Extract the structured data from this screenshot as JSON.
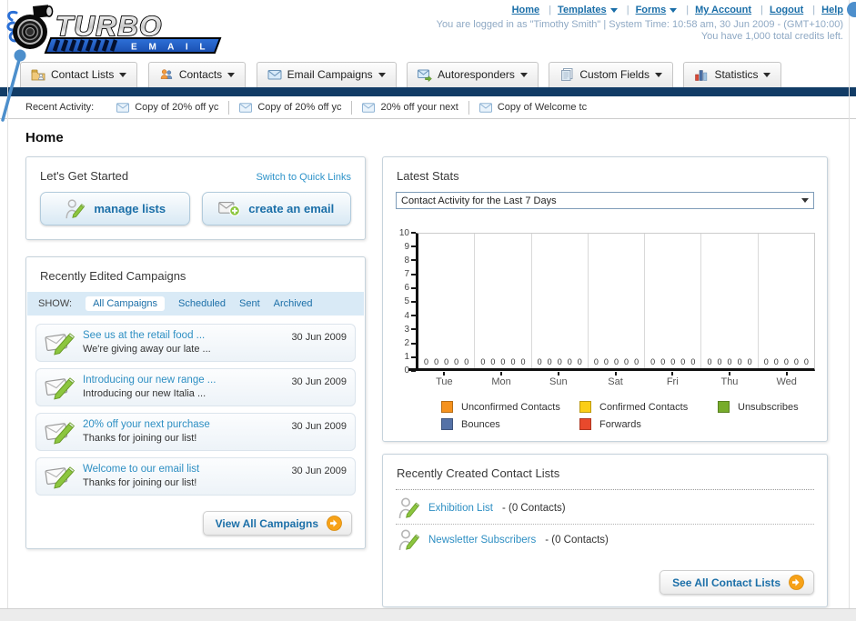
{
  "brand": {
    "name": "TURBO",
    "sub": "E M A I L"
  },
  "header": {
    "nav_links": [
      {
        "label": "Home",
        "dropdown": false
      },
      {
        "label": "Templates",
        "dropdown": true
      },
      {
        "label": "Forms",
        "dropdown": true
      },
      {
        "label": "My Account",
        "dropdown": false
      },
      {
        "label": "Logout",
        "dropdown": false
      },
      {
        "label": "Help",
        "dropdown": false
      }
    ],
    "login_line1": "You are logged in as \"Timothy Smith\" | System Time: 10:58 am, 30 Jun 2009 - (GMT+10:00)",
    "login_line2": "You have 1,000 total credits left."
  },
  "main_nav": {
    "tabs": [
      {
        "label": "Contact Lists",
        "icon": "contact-lists-icon"
      },
      {
        "label": "Contacts",
        "icon": "contacts-icon"
      },
      {
        "label": "Email Campaigns",
        "icon": "email-campaigns-icon"
      },
      {
        "label": "Autoresponders",
        "icon": "autoresponders-icon"
      },
      {
        "label": "Custom Fields",
        "icon": "custom-fields-icon"
      },
      {
        "label": "Statistics",
        "icon": "statistics-icon"
      }
    ]
  },
  "recent_activity": {
    "label": "Recent Activity:",
    "items": [
      {
        "label": "Copy of 20% off yc",
        "icon": "envelope-icon"
      },
      {
        "label": "Copy of 20% off yc",
        "icon": "envelope-icon"
      },
      {
        "label": "20% off your next ",
        "icon": "envelope-icon"
      },
      {
        "label": "Copy of Welcome tc",
        "icon": "envelope-icon"
      }
    ]
  },
  "page_title": "Home",
  "get_started": {
    "title": "Let's Get Started",
    "switch_link": "Switch to Quick Links",
    "buttons": [
      {
        "label": "manage lists",
        "icon": "person-pencil-icon"
      },
      {
        "label": "create an email",
        "icon": "envelope-plus-icon"
      }
    ]
  },
  "campaigns": {
    "title": "Recently Edited Campaigns",
    "show_label": "SHOW:",
    "filters": [
      {
        "label": "All Campaigns",
        "active": true
      },
      {
        "label": "Scheduled",
        "active": false
      },
      {
        "label": "Sent",
        "active": false
      },
      {
        "label": "Archived",
        "active": false
      }
    ],
    "items": [
      {
        "title": "See us at the retail food ...",
        "subtitle": "We're giving away our late ...",
        "date": "30 Jun 2009",
        "icon": "envelope-pencil-icon"
      },
      {
        "title": "Introducing our new range ...",
        "subtitle": "Introducing our new Italia ...",
        "date": "30 Jun 2009",
        "icon": "envelope-pencil-icon"
      },
      {
        "title": "20% off your next purchase",
        "subtitle": "Thanks for joining our list!",
        "date": "30 Jun 2009",
        "icon": "envelope-pencil-icon"
      },
      {
        "title": "Welcome to our email list",
        "subtitle": "Thanks for joining our list!",
        "date": "30 Jun 2009",
        "icon": "envelope-pencil-icon"
      }
    ],
    "view_all_label": "View All Campaigns"
  },
  "latest_stats": {
    "title": "Latest Stats",
    "selected_option": "Contact Activity for the Last 7 Days"
  },
  "chart_data": {
    "type": "bar",
    "categories": [
      "Tue",
      "Mon",
      "Sun",
      "Sat",
      "Fri",
      "Thu",
      "Wed"
    ],
    "series": [
      {
        "name": "Unconfirmed Contacts",
        "color": "#F5921E",
        "values": [
          0,
          0,
          0,
          0,
          0,
          0,
          0
        ]
      },
      {
        "name": "Confirmed Contacts",
        "color": "#FBCE17",
        "values": [
          0,
          0,
          0,
          0,
          0,
          0,
          0
        ]
      },
      {
        "name": "Unsubscribes",
        "color": "#77AC2B",
        "values": [
          0,
          0,
          0,
          0,
          0,
          0,
          0
        ]
      },
      {
        "name": "Bounces",
        "color": "#5572A7",
        "values": [
          0,
          0,
          0,
          0,
          0,
          0,
          0
        ]
      },
      {
        "name": "Forwards",
        "color": "#E8492C",
        "values": [
          0,
          0,
          0,
          0,
          0,
          0,
          0
        ]
      }
    ],
    "title": "Contact Activity for the Last 7 Days",
    "xlabel": "",
    "ylabel": "",
    "ylim": [
      0,
      10
    ],
    "ytick_step": 1,
    "grid": "vertical",
    "legend_position": "bottom"
  },
  "contact_lists": {
    "title": "Recently Created Contact Lists",
    "items": [
      {
        "name": "Exhibition List",
        "dash_count": "- (0 Contacts)",
        "icon": "person-pencil-icon"
      },
      {
        "name": "Newsletter Subscribers",
        "dash_count": "- (0 Contacts)",
        "icon": "person-pencil-icon"
      }
    ],
    "see_all_label": "See All Contact Lists"
  },
  "colors": {
    "navy_bar": "#123C66",
    "accent_blue": "#1B6FA8",
    "link_blue": "#2E93C9",
    "decorative_blue": "#4D8FCC"
  }
}
